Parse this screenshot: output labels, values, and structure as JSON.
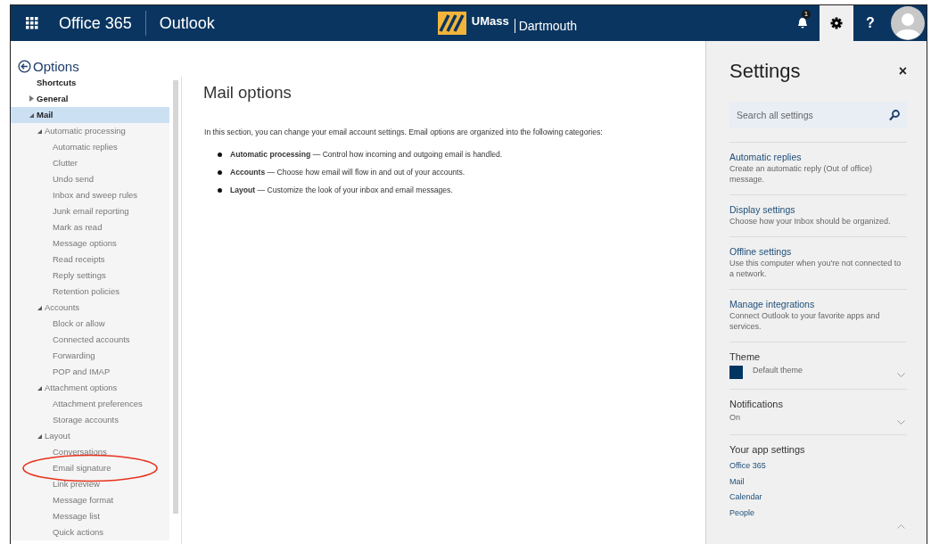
{
  "topbar": {
    "suite": "Office 365",
    "app": "Outlook",
    "logo": {
      "name": "UMass",
      "sub": "Dartmouth"
    },
    "notification_count": "1",
    "settings_selected": true,
    "help": "?"
  },
  "nav": {
    "back_label": "Options",
    "items": [
      {
        "label": "Shortcuts",
        "selected": false
      },
      {
        "label": "General",
        "selected": false,
        "expanded": false
      },
      {
        "label": "Mail",
        "selected": true,
        "expanded": true,
        "children": [
          {
            "label": "Automatic processing",
            "selected": false,
            "expanded": true,
            "children": [
              {
                "label": "Automatic replies",
                "selected": false
              },
              {
                "label": "Clutter",
                "selected": false
              },
              {
                "label": "Undo send",
                "selected": false
              },
              {
                "label": "Inbox and sweep rules",
                "selected": false
              },
              {
                "label": "Junk email reporting",
                "selected": false
              },
              {
                "label": "Mark as read",
                "selected": false
              },
              {
                "label": "Message options",
                "selected": false
              },
              {
                "label": "Read receipts",
                "selected": false
              },
              {
                "label": "Reply settings",
                "selected": false
              },
              {
                "label": "Retention policies",
                "selected": false
              }
            ]
          },
          {
            "label": "Accounts",
            "selected": false,
            "expanded": true,
            "children": [
              {
                "label": "Block or allow",
                "selected": false
              },
              {
                "label": "Connected accounts",
                "selected": false
              },
              {
                "label": "Forwarding",
                "selected": false
              },
              {
                "label": "POP and IMAP",
                "selected": false
              }
            ]
          },
          {
            "label": "Attachment options",
            "selected": false,
            "expanded": true,
            "children": [
              {
                "label": "Attachment preferences",
                "selected": false
              },
              {
                "label": "Storage accounts",
                "selected": false
              }
            ]
          },
          {
            "label": "Layout",
            "selected": false,
            "expanded": true,
            "children": [
              {
                "label": "Conversations",
                "selected": false
              },
              {
                "label": "Email signature",
                "selected": false,
                "circled": true
              },
              {
                "label": "Link preview",
                "selected": false
              },
              {
                "label": "Message format",
                "selected": false
              },
              {
                "label": "Message list",
                "selected": false
              },
              {
                "label": "Quick actions",
                "selected": false
              }
            ]
          }
        ]
      }
    ]
  },
  "content": {
    "title": "Mail options",
    "intro": "In this section, you can change your email account settings. Email options are organized into the following categories:",
    "bullets": [
      "**Automatic processing** — Control how incoming and outgoing email is handled.",
      "**Accounts** — Choose how email will flow in and out of your accounts.",
      "**Layout** — Customize the look of your inbox and email messages."
    ]
  },
  "settings": {
    "title": "Settings",
    "close": "×",
    "search": {
      "placeholder": "Search all settings"
    },
    "links": [
      {
        "title": "Automatic replies",
        "description": "Create an automatic reply (Out of office) message."
      },
      {
        "title": "Display settings",
        "description": "Choose how your Inbox should be organized."
      },
      {
        "title": "Offline settings",
        "description": "Use this computer when you're not connected to a network."
      },
      {
        "title": "Manage integrations",
        "description": "Connect Outlook to your favorite apps and services."
      }
    ],
    "theme": {
      "label": "Theme",
      "value": "Default theme",
      "color": "#003561"
    },
    "notifications": {
      "label": "Notifications",
      "value": "On"
    },
    "app_settings": {
      "heading": "Your app settings",
      "links": [
        "Office 365",
        "Mail",
        "Calendar",
        "People"
      ]
    }
  }
}
